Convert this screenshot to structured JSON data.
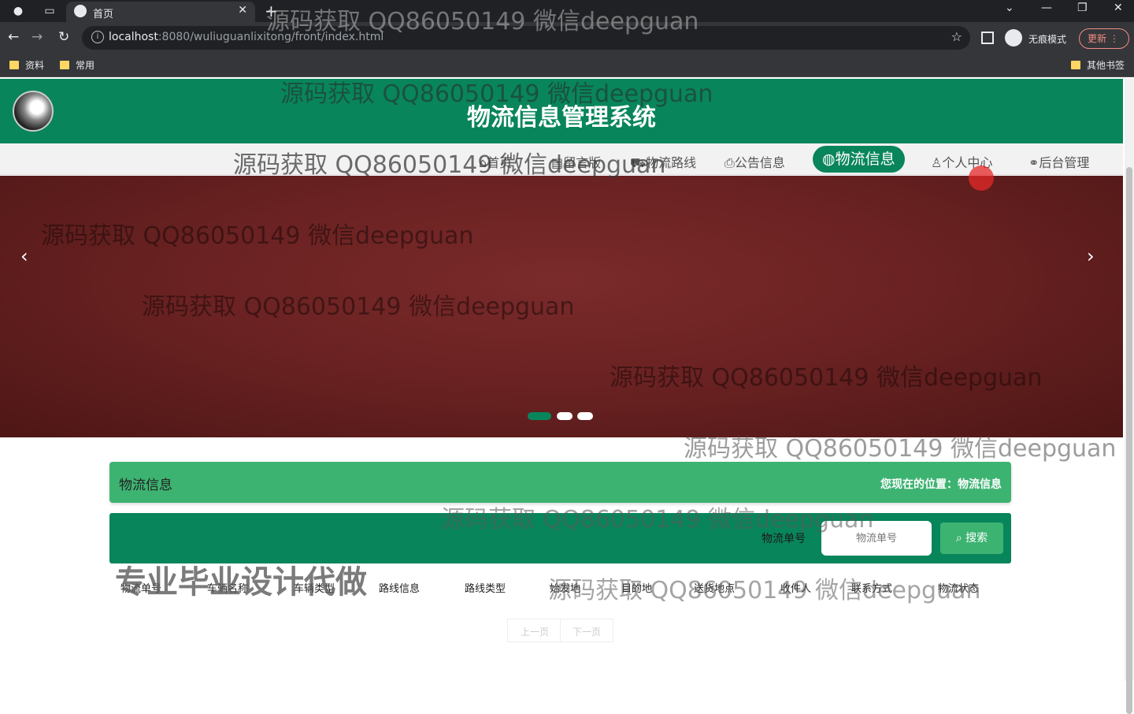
{
  "browser": {
    "tab_title": "首页",
    "url_host": "localhost",
    "url_rest": ":8080/wuliuguanlixitong/front/index.html",
    "incognito_label": "无痕模式",
    "update_label": "更新",
    "bookmarks": [
      "资料",
      "常用"
    ],
    "other_bookmarks": "其他书签"
  },
  "site": {
    "title": "物流信息管理系统"
  },
  "nav": {
    "items": [
      {
        "label": "首页"
      },
      {
        "label": "留言版"
      },
      {
        "label": "物流路线"
      },
      {
        "label": "公告信息"
      },
      {
        "label": "物流信息"
      },
      {
        "label": "个人中心"
      },
      {
        "label": "后台管理"
      }
    ],
    "active": "物流信息"
  },
  "carousel": {
    "slide_count": 3,
    "active_index": 0
  },
  "section": {
    "title": "物流信息",
    "breadcrumb": "您现在的位置：物流信息"
  },
  "search": {
    "label": "物流单号",
    "placeholder": "物流单号",
    "button": "搜索"
  },
  "table": {
    "columns": [
      "物流单号",
      "车辆名称",
      "车辆类型",
      "路线信息",
      "路线类型",
      "始发地",
      "目的地",
      "送货地点",
      "收件人",
      "联系方式",
      "物流状态"
    ]
  },
  "pager": {
    "prev": "上一页",
    "next": "下一页"
  },
  "overlay": {
    "watermark": "源码获取 QQ86050149 微信deepguan",
    "promo": "专业毕业设计代做"
  },
  "colors": {
    "primary": "#09855b",
    "accent": "#3db371",
    "carousel": "#6b2222"
  }
}
